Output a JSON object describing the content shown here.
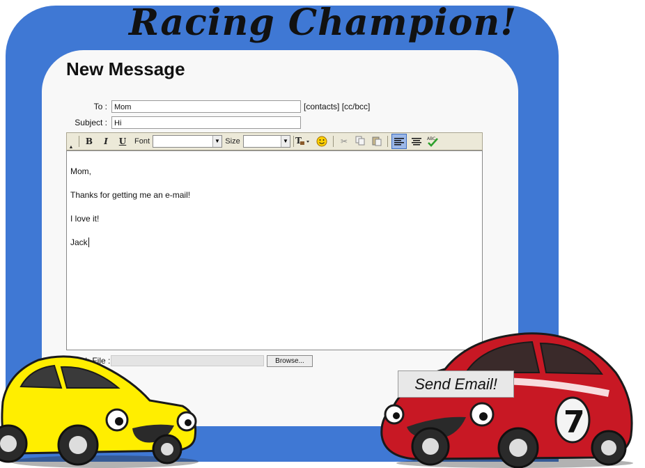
{
  "app": {
    "title": "Racing Champion!"
  },
  "page": {
    "title": "New Message"
  },
  "form": {
    "to_label": "To :",
    "to_value": "Mom",
    "contacts_link": "[contacts]",
    "ccbcc_link": "[cc/bcc]",
    "subject_label": "Subject :",
    "subject_value": "Hi"
  },
  "toolbar": {
    "bold": "B",
    "italic": "I",
    "underline": "U",
    "font_label": "Font",
    "font_value": "",
    "size_label": "Size",
    "size_value": "",
    "spellcheck_label": "ABC",
    "icons": [
      "collapse-toggle-icon",
      "bold-icon",
      "italic-icon",
      "underline-icon",
      "text-color-icon",
      "emoticon-icon",
      "cut-icon",
      "copy-icon",
      "paste-icon",
      "align-left-icon",
      "align-center-icon",
      "spellcheck-icon"
    ]
  },
  "body": {
    "lines": [
      "Mom,",
      "Thanks for getting me an e-mail!",
      "I love it!",
      "Jack"
    ]
  },
  "attach": {
    "label": "Attach File :",
    "browse_label": "Browse..."
  },
  "send": {
    "label": "Send Email!"
  },
  "car_badge": "7",
  "colors": {
    "frame": "#3f78d4",
    "panel": "#f8f8f8",
    "yellow_car": "#ffee00",
    "red_car": "#c81824"
  }
}
